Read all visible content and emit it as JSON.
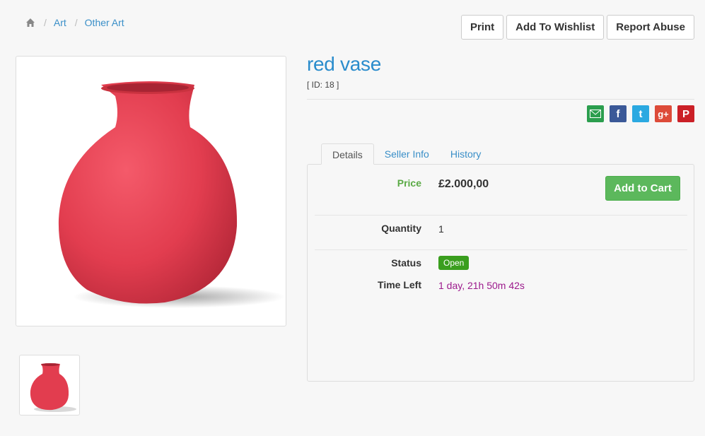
{
  "breadcrumb": {
    "home_icon": "home-icon",
    "items": [
      "Art",
      "Other Art"
    ]
  },
  "actions": {
    "print": "Print",
    "wishlist": "Add To Wishlist",
    "report": "Report Abuse"
  },
  "item": {
    "title": "red vase",
    "id_text": "[ ID: 18 ]"
  },
  "share_icons": [
    "email-icon",
    "facebook-icon",
    "twitter-icon",
    "google-plus-icon",
    "pinterest-icon"
  ],
  "tabs": [
    "Details",
    "Seller Info",
    "History"
  ],
  "details": {
    "price_label": "Price",
    "price_value": "£2.000,00",
    "add_to_cart": "Add to Cart",
    "quantity_label": "Quantity",
    "quantity_value": "1",
    "status_label": "Status",
    "status_value": "Open",
    "time_left_label": "Time Left",
    "time_left_value": "1 day, 21h 50m 42s"
  },
  "colors": {
    "link": "#2a8ccc",
    "price_label": "#5aaa45",
    "cart_button": "#5cb85c",
    "status_badge": "#3a9e1e",
    "time_left": "#9c1a8c",
    "vase": "#e23d4f"
  }
}
